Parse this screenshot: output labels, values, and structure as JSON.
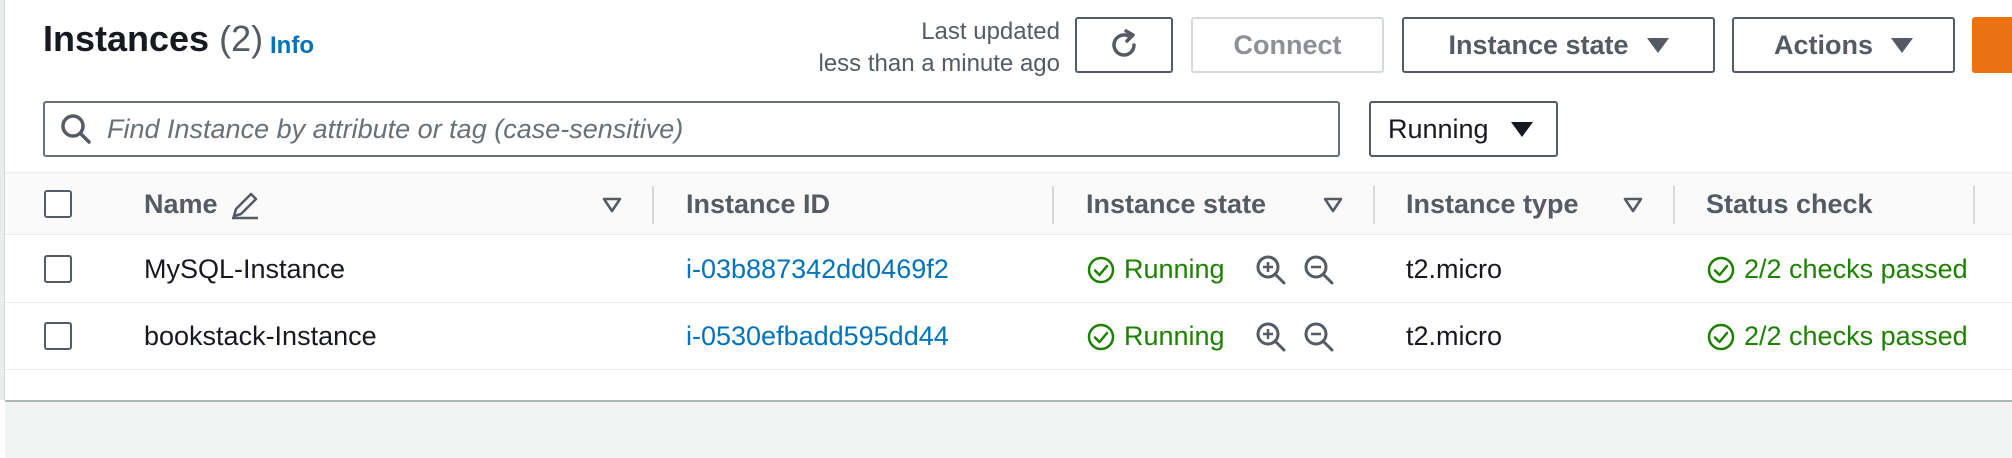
{
  "header": {
    "title": "Instances",
    "count": "(2)",
    "info": "Info",
    "last_updated_line1": "Last updated",
    "last_updated_line2": "less than a minute ago"
  },
  "toolbar": {
    "connect_label": "Connect",
    "instance_state_label": "Instance state",
    "actions_label": "Actions"
  },
  "search": {
    "placeholder": "Find Instance by attribute or tag (case-sensitive)"
  },
  "filter": {
    "selected": "Running"
  },
  "table": {
    "columns": [
      "Name",
      "Instance ID",
      "Instance state",
      "Instance type",
      "Status check"
    ],
    "rows": [
      {
        "name": "MySQL-Instance",
        "id": "i-03b887342dd0469f2",
        "state": "Running",
        "type": "t2.micro",
        "status": "2/2 checks passed"
      },
      {
        "name": "bookstack-Instance",
        "id": "i-0530efbadd595dd44",
        "state": "Running",
        "type": "t2.micro",
        "status": "2/2 checks passed"
      }
    ]
  },
  "colors": {
    "link": "#0073bb",
    "success": "#1d8102",
    "primary": "#ec7211"
  },
  "icons": [
    "refresh-icon",
    "caret-down-icon",
    "search-icon",
    "edit-icon",
    "sort-icon",
    "success-icon",
    "zoom-in-icon",
    "zoom-out-icon"
  ]
}
